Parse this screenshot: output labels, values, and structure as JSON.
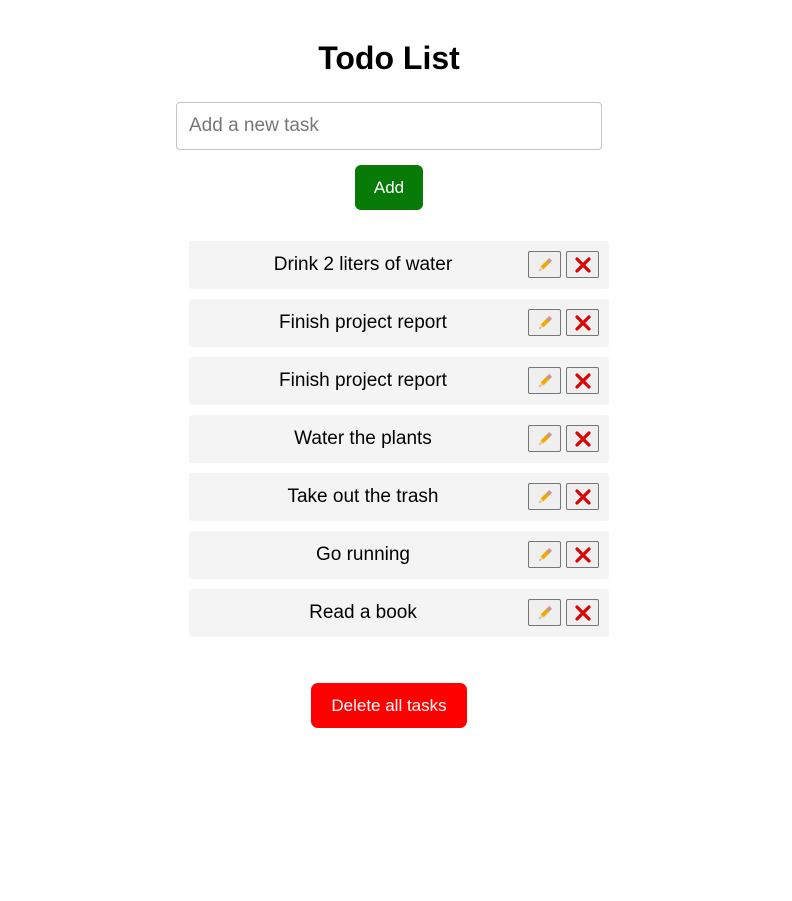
{
  "app": {
    "title": "Todo List"
  },
  "input": {
    "placeholder": "Add a new task",
    "value": ""
  },
  "add_button": {
    "label": "Add"
  },
  "tasks": [
    {
      "text": "Drink 2 liters of water"
    },
    {
      "text": "Finish project report"
    },
    {
      "text": "Finish project report"
    },
    {
      "text": "Water the plants"
    },
    {
      "text": "Take out the trash"
    },
    {
      "text": "Go running"
    },
    {
      "text": "Read a book"
    }
  ],
  "task_actions": {
    "edit_icon": "pencil-icon",
    "delete_icon": "cross-mark-icon"
  },
  "delete_all_button": {
    "label": "Delete all tasks"
  },
  "colors": {
    "add_button": "#077a07",
    "delete_all_button": "#ff0000",
    "delete_icon": "#e00000",
    "task_background": "#f4f4f4"
  }
}
